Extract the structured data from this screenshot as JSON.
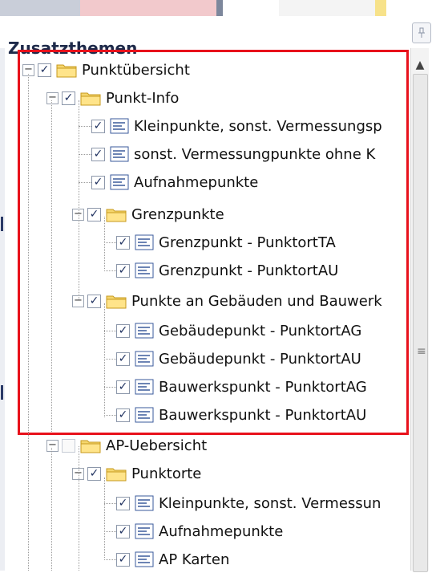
{
  "panel": {
    "title": "Zusatzthemen",
    "pin_icon": "pin-icon",
    "highlight_color": "#e8111b"
  },
  "tree": [
    {
      "label": "Punktübersicht",
      "type": "folder",
      "checked": true,
      "expanded": true
    },
    {
      "label": "Punkt-Info",
      "type": "folder",
      "checked": true,
      "expanded": true
    },
    {
      "label": "Kleinpunkte, sonst. Vermessungsp",
      "type": "layer",
      "checked": true
    },
    {
      "label": "sonst. Vermessungpunkte ohne K",
      "type": "layer",
      "checked": true
    },
    {
      "label": "Aufnahmepunkte",
      "type": "layer",
      "checked": true
    },
    {
      "label": "Grenzpunkte",
      "type": "folder",
      "checked": true,
      "expanded": true
    },
    {
      "label": "Grenzpunkt - PunktortTA",
      "type": "layer",
      "checked": true
    },
    {
      "label": "Grenzpunkt - PunktortAU",
      "type": "layer",
      "checked": true
    },
    {
      "label": "Punkte an Gebäuden und Bauwerk",
      "type": "folder",
      "checked": true,
      "expanded": true
    },
    {
      "label": "Gebäudepunkt - PunktortAG",
      "type": "layer",
      "checked": true
    },
    {
      "label": "Gebäudepunkt - PunktortAU",
      "type": "layer",
      "checked": true
    },
    {
      "label": "Bauwerkspunkt - PunktortAG",
      "type": "layer",
      "checked": true
    },
    {
      "label": "Bauwerkspunkt - PunktortAU",
      "type": "layer",
      "checked": true
    },
    {
      "label": "AP-Uebersicht",
      "type": "folder",
      "checked": false,
      "expanded": true
    },
    {
      "label": "Punktorte",
      "type": "folder",
      "checked": true,
      "expanded": true
    },
    {
      "label": "Kleinpunkte, sonst. Vermessun",
      "type": "layer",
      "checked": true
    },
    {
      "label": "Aufnahmepunkte",
      "type": "layer",
      "checked": true
    },
    {
      "label": "AP Karten",
      "type": "layer",
      "checked": true
    }
  ],
  "icons": {
    "folder": "folder-icon",
    "layer": "layer-icon",
    "scroll_up": "scroll-up-arrow-icon",
    "scroll_grip": "scroll-grip-icon"
  }
}
